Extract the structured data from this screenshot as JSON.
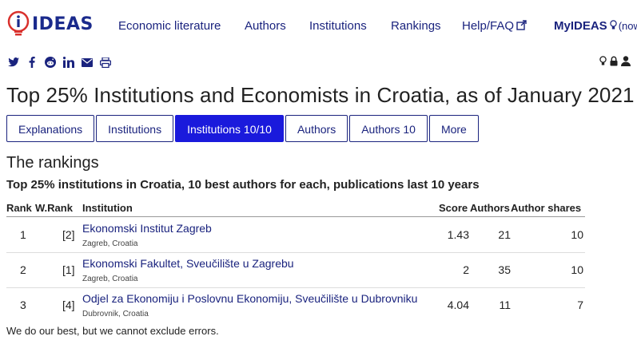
{
  "logo": {
    "text": "IDEAS",
    "icon": "ideas-bulb-icon"
  },
  "nav": {
    "economic_literature": "Economic literature",
    "authors": "Authors",
    "institutions": "Institutions",
    "rankings": "Rankings",
    "help": "Help/FAQ",
    "myideas": "MyIDEAS",
    "myideas_suffix": "(now"
  },
  "share_icons": [
    "twitter-icon",
    "facebook-icon",
    "reddit-icon",
    "linkedin-icon",
    "email-icon",
    "print-icon"
  ],
  "page_title": "Top 25% Institutions and Economists in Croatia, as of January 2021",
  "tabs": [
    {
      "label": "Explanations",
      "active": false
    },
    {
      "label": "Institutions",
      "active": false
    },
    {
      "label": "Institutions 10/10",
      "active": true
    },
    {
      "label": "Authors",
      "active": false
    },
    {
      "label": "Authors 10",
      "active": false
    },
    {
      "label": "More",
      "active": false
    }
  ],
  "section_title": "The rankings",
  "subtitle": "Top 25% institutions in Croatia, 10 best authors for each, publications last 10 years",
  "table": {
    "headers": {
      "rank": "Rank",
      "wrank": "W.Rank",
      "institution": "Institution",
      "score": "Score",
      "authors": "Authors",
      "shares": "Author shares"
    },
    "rows": [
      {
        "rank": "1",
        "wrank": "[2]",
        "name": "Ekonomski Institut Zagreb",
        "location": "Zagreb, Croatia",
        "score": "1.43",
        "authors": "21",
        "shares": "10"
      },
      {
        "rank": "2",
        "wrank": "[1]",
        "name": "Ekonomski Fakultet, Sveučilište u Zagrebu",
        "location": "Zagreb, Croatia",
        "score": "2",
        "authors": "35",
        "shares": "10"
      },
      {
        "rank": "3",
        "wrank": "[4]",
        "name": "Odjel za Ekonomiju i Poslovnu Ekonomiju, Sveučilište u Dubrovniku",
        "location": "Dubrovnik, Croatia",
        "score": "4.04",
        "authors": "11",
        "shares": "7"
      }
    ]
  },
  "footer_note": "We do our best, but we cannot exclude errors.",
  "colors": {
    "brand": "#1a237e",
    "active_tab": "#1a1adc",
    "logo_red": "#d9302c"
  }
}
